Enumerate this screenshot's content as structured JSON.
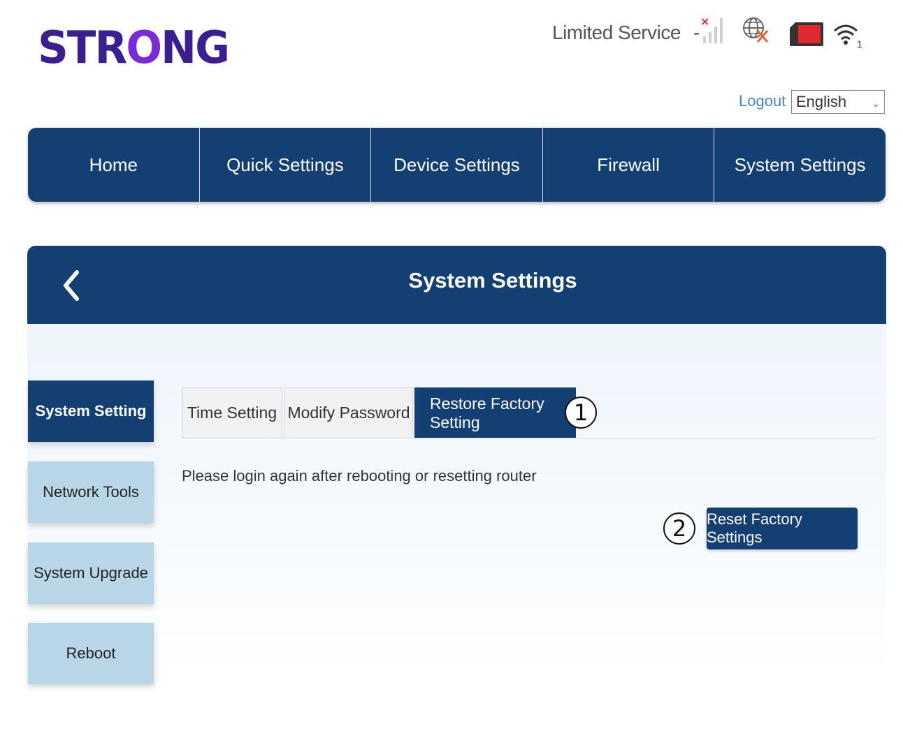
{
  "brand": {
    "logo_text_pre": "STR",
    "logo_text_o": "O",
    "logo_text_post": "NG"
  },
  "status": {
    "service_text": "Limited Service",
    "separator": "-",
    "icons": [
      "signal-no-service-icon",
      "globe-disconnected-icon",
      "sim-card-icon",
      "wifi-icon"
    ],
    "wifi_clients": "1",
    "signal_error_mark": "×"
  },
  "header": {
    "logout_label": "Logout",
    "language_selected": "English"
  },
  "nav": {
    "items": [
      {
        "label": "Home"
      },
      {
        "label": "Quick Settings"
      },
      {
        "label": "Device Settings"
      },
      {
        "label": "Firewall"
      },
      {
        "label": "System Settings"
      }
    ]
  },
  "panel": {
    "title": "System Settings",
    "back_icon": "chevron-left-icon"
  },
  "sidebar": {
    "items": [
      {
        "label": "System Setting",
        "active": true
      },
      {
        "label": "Network Tools"
      },
      {
        "label": "System Upgrade"
      },
      {
        "label": "Reboot"
      }
    ]
  },
  "tabs": [
    {
      "label": "Time Setting"
    },
    {
      "label": "Modify Password"
    },
    {
      "label": "Restore Factory Setting",
      "active": true
    }
  ],
  "content": {
    "note": "Please login again after rebooting or resetting router",
    "reset_button_label": "Reset Factory Settings"
  },
  "callouts": {
    "one": "1",
    "two": "2"
  },
  "colors": {
    "primary": "#133f73",
    "sidebar_inactive": "#b8d6e8",
    "link": "#4a86b8",
    "sim_red": "#e0282e"
  }
}
